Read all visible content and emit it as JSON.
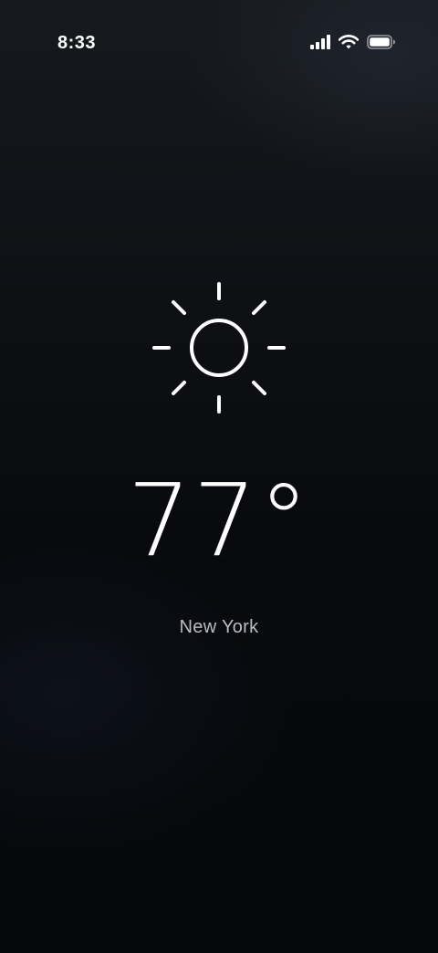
{
  "status_bar": {
    "time": "8:33",
    "icons": [
      "cellular-signal-icon",
      "wifi-icon",
      "battery-icon"
    ]
  },
  "weather": {
    "condition_icon": "sun-icon",
    "temperature": "77°",
    "city": "New York"
  },
  "colors": {
    "background": "#07090c",
    "text_primary": "#ffffff",
    "text_secondary": "#b9bcc2"
  }
}
